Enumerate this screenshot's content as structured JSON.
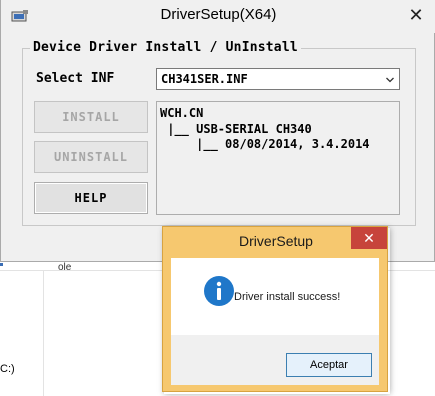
{
  "main_window": {
    "title": "DriverSetup(X64)",
    "close_glyph": "✕",
    "group_title": "Device Driver Install / UnInstall",
    "select_label": "Select INF",
    "inf_selected": "CH341SER.INF",
    "buttons": {
      "install": "INSTALL",
      "uninstall": "UNINSTALL",
      "help": "HELP"
    },
    "tree": {
      "line1": "WCH.CN",
      "line2": " |__ USB-SERIAL CH340",
      "line3": "     |__ 08/08/2014, 3.4.2014"
    }
  },
  "message_box": {
    "title": "DriverSetup",
    "close_glyph": "✕",
    "message": "Driver install success!",
    "ok_button": "Aceptar"
  },
  "background": {
    "tab_label": "ole",
    "drive_label": "C:)"
  },
  "colors": {
    "dialog_title_bar": "#f6c86f",
    "close_button_red": "#c7443b",
    "info_icon_blue": "#1f77c9"
  }
}
